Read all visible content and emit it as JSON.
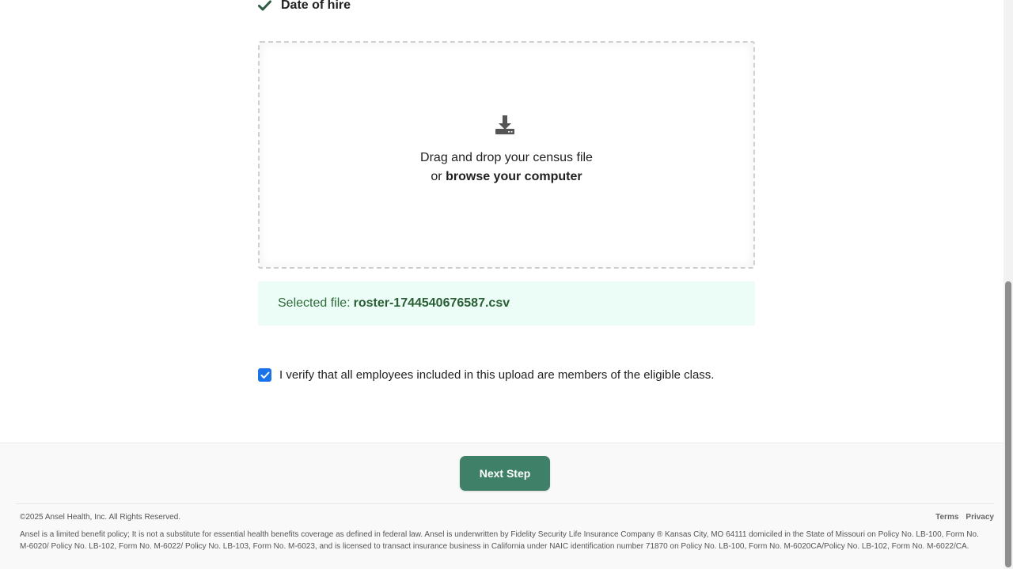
{
  "requirements": {
    "last_item_label": "Date of hire"
  },
  "upload": {
    "line1": "Drag and drop your census file",
    "line2_prefix": "or",
    "browse_link": "browse your computer"
  },
  "selected_file": {
    "prefix": "Selected file:",
    "name": "roster-1744540676587.csv"
  },
  "verify": {
    "checked": true,
    "label": "I verify that all employees included in this upload are members of the eligible class."
  },
  "footer": {
    "next_button": "Next Step",
    "copyright": "©2025 Ansel Health, Inc. All Rights Reserved.",
    "links": [
      "Terms",
      "Privacy"
    ],
    "disclaimer": "Ansel is a limited benefit policy; It is not a substitute for essential health benefits coverage as defined in federal law. Ansel is underwritten by Fidelity Security Life Insurance Company ® Kansas City, MO 64111 domiciled in the State of Missouri on Policy No. LB-100, Form No. M-6020/ Policy No. LB-102, Form No. M-6022/ Policy No. LB-103, Form No. M-6023, and is licensed to transact insurance business in California under NAIC identification number 71870 on Policy No. LB-100, Form No. M-6020CA/Policy No. LB-102, Form No. M-6022/CA."
  },
  "colors": {
    "accent_green": "#3f8168",
    "checkbox_blue": "#1a73e8",
    "file_banner_bg": "#ebfdf6",
    "check_icon": "#2e5b45"
  }
}
